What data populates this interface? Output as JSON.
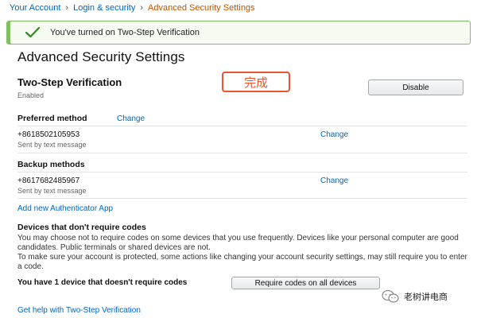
{
  "breadcrumb": {
    "items": [
      "Your Account",
      "Login & security"
    ],
    "current": "Advanced Security Settings",
    "separator": "›"
  },
  "alert": {
    "message": "You've turned on Two-Step Verification",
    "color": "#7fbf60"
  },
  "page_title": "Advanced Security Settings",
  "two_step": {
    "heading": "Two-Step Verification",
    "status": "Enabled",
    "disable_label": "Disable",
    "stamp": "完成"
  },
  "preferred": {
    "heading": "Preferred method",
    "change_label": "Change",
    "phone": "+8618502105953",
    "sub": "Sent by text message",
    "row_change_label": "Change"
  },
  "backup": {
    "heading": "Backup methods",
    "phone": "+8617682485967",
    "sub": "Sent by text message",
    "change_label": "Change"
  },
  "add_authenticator": "Add new Authenticator App",
  "devices": {
    "heading": "Devices that don't require codes",
    "paragraph1": "You may choose not to require codes on some devices that you use frequently. Devices like your personal computer are good candidates. Public terminals or shared devices are not.",
    "paragraph2": "To make sure your account is protected, some actions like changing your account security settings, may still require you to enter a code.",
    "count_text": "You have 1 device that doesn't require codes",
    "require_button": "Require codes on all devices"
  },
  "help_link": "Get help with Two-Step Verification",
  "watermark": "老树讲电商",
  "colors": {
    "link": "#0066c0",
    "breadcrumb_current": "#c45500",
    "stamp": "#e8572e"
  }
}
